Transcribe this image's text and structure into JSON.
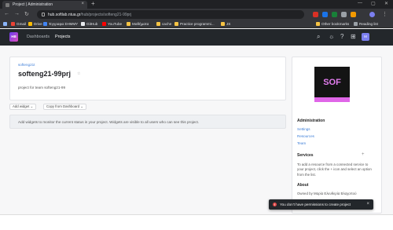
{
  "browser": {
    "tab_title": "Project | Administration",
    "tab_close": "×",
    "new_tab": "+",
    "window_controls": [
      "—",
      "▢",
      "✕"
    ],
    "nav": [
      "←",
      "→",
      "↻"
    ],
    "url_host": "hub.softlab.ntua.gr",
    "url_path": "/hub/projects/softeng21-99prj",
    "bookmarks": [
      "Gmail",
      "Drive",
      "Έγγραφα ΣΗΜΜΥ",
      "GitHub",
      "YouTube",
      "Μαθήματα",
      "cache",
      "Practice programmi...",
      "JS"
    ],
    "bookmarks_right": [
      "Other bookmarks",
      "Reading list"
    ],
    "colors": {
      "chrome_dark": "#202124",
      "chrome_mid": "#35363a"
    }
  },
  "header": {
    "logo_text": "HB",
    "nav": [
      {
        "label": "Dashboards",
        "active": false
      },
      {
        "label": "Projects",
        "active": true
      }
    ],
    "icons": [
      "search-icon",
      "help-icon",
      "settings-icon",
      "apps-icon"
    ],
    "icon_glyphs": [
      "⌕",
      "☼",
      "?",
      "⊞"
    ],
    "avatar_text": "M"
  },
  "project": {
    "breadcrumb": "softeng21t",
    "title": "softeng21-99prj",
    "star": "☆",
    "description": "project for team softeng21-99"
  },
  "actions": {
    "add_widget": "Add widget ⌄",
    "copy_dashboard": "Copy from Dashboard ⌄"
  },
  "hint": "Add widgets to monitor the current status in your project. Widgets are visible to all users who can see this project.",
  "sidebar": {
    "logo_text": "SOF",
    "admin_title": "Administration",
    "admin_links": [
      "Settings",
      "Resources",
      "Team"
    ],
    "services_title": "Services",
    "services_plus": "+",
    "services_text": "To add a resource from a connected service to your project, click the + icon and select an option from the list.",
    "about_title": "About",
    "owned_by": "Owned by Μαρία Ελευθερία Βλαχοπού"
  },
  "toast": {
    "message": "You don't have permissions to create project",
    "icon": "!",
    "close": "×",
    "color": "#e04a4a"
  }
}
